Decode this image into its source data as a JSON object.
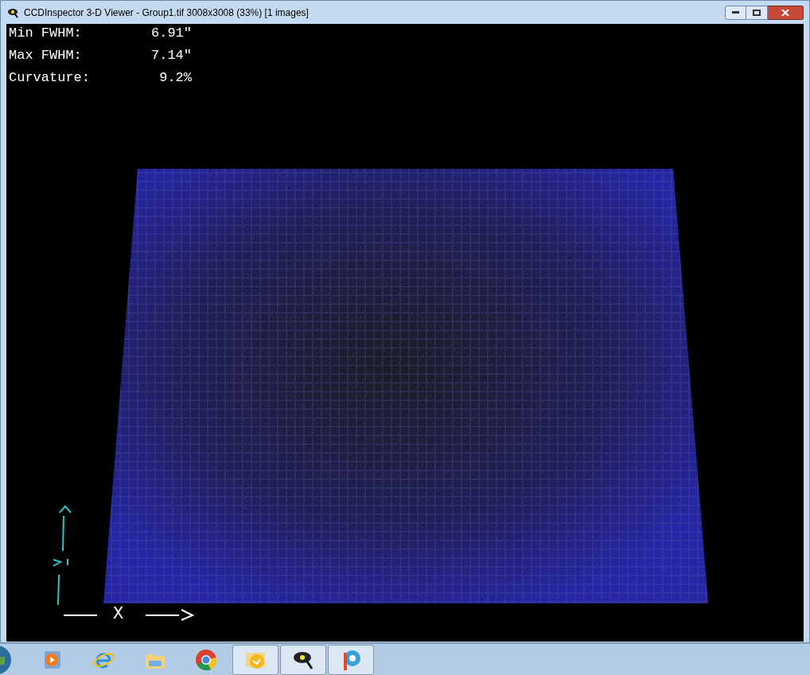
{
  "window": {
    "title": "CCDInspector 3-D Viewer - Group1.tif 3008x3008 (33%)  [1 images]"
  },
  "stats": [
    {
      "label": "Min FWHM:",
      "value": "6.91\""
    },
    {
      "label": "Max FWHM:",
      "value": "7.14\""
    },
    {
      "label": "Curvature:",
      "value": "9.2%"
    }
  ],
  "axes": {
    "x_label": "X"
  },
  "taskbar": {
    "items": [
      {
        "kind": "media",
        "running": false
      },
      {
        "kind": "browser-e",
        "running": false
      },
      {
        "kind": "folder",
        "running": false
      },
      {
        "kind": "chrome",
        "running": false
      },
      {
        "kind": "mail",
        "running": true
      },
      {
        "kind": "inspector",
        "running": true
      },
      {
        "kind": "paint",
        "running": true
      }
    ]
  }
}
